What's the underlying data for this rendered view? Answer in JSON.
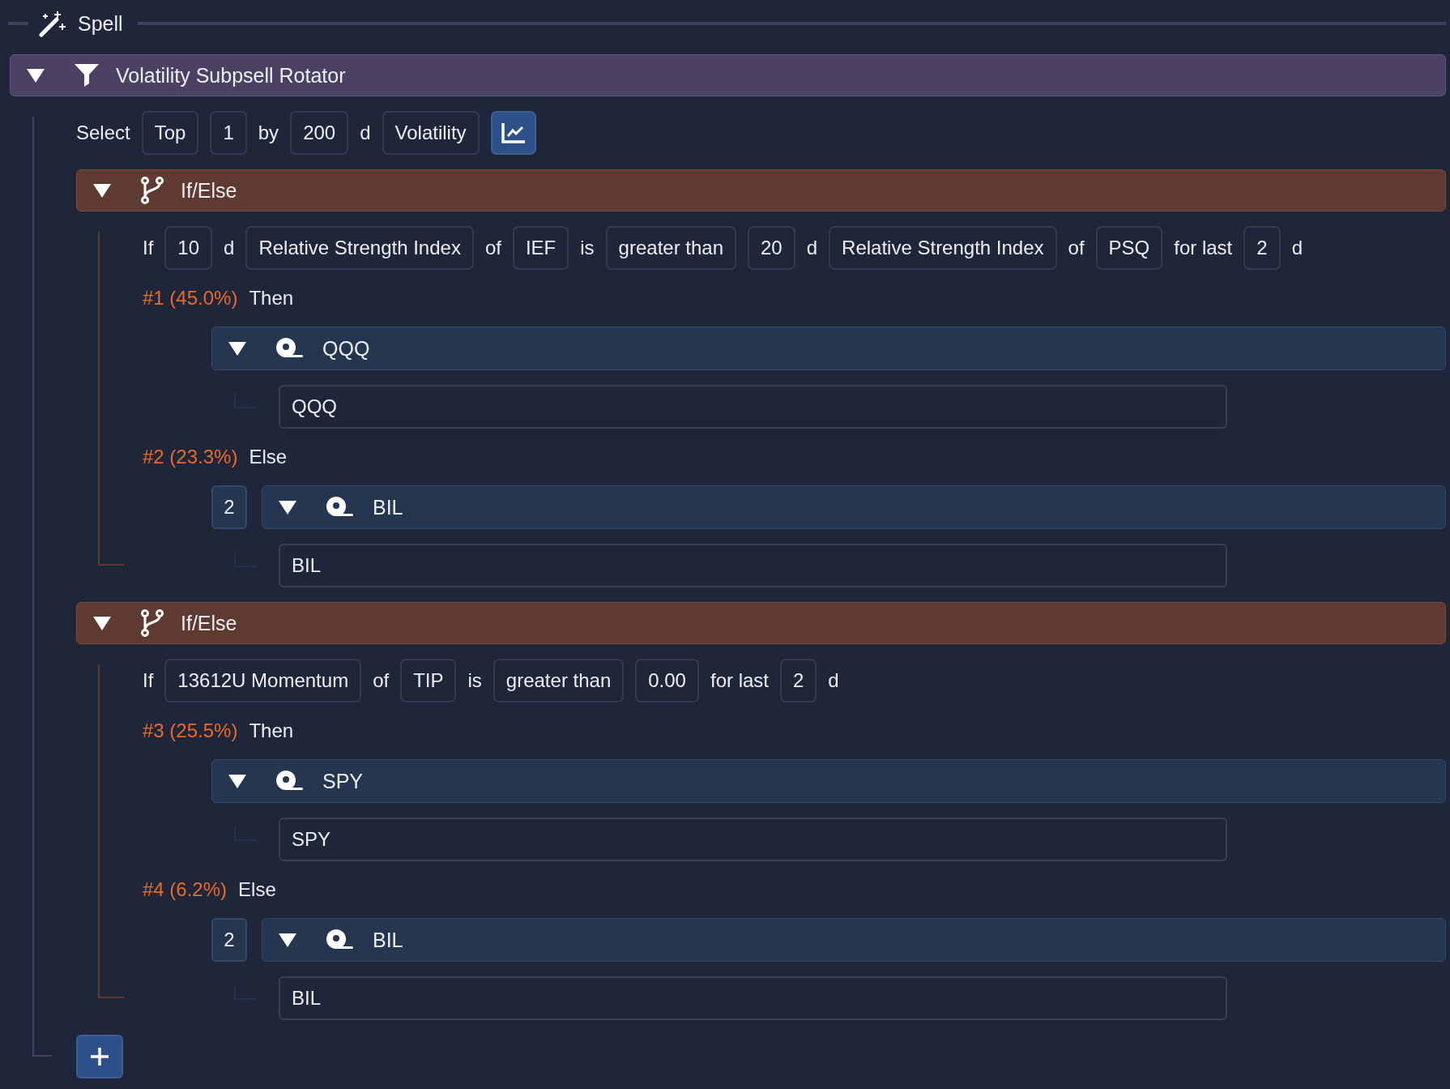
{
  "header": {
    "title": "Spell"
  },
  "filter": {
    "title": "Volatility Subpsell Rotator",
    "expanded": true,
    "select": [
      {
        "kind": "text",
        "text": "Select"
      },
      {
        "kind": "field",
        "text": "Top"
      },
      {
        "kind": "field",
        "text": "1"
      },
      {
        "kind": "text",
        "text": "by"
      },
      {
        "kind": "field",
        "text": "200"
      },
      {
        "kind": "text",
        "text": "d"
      },
      {
        "kind": "field",
        "text": "Volatility"
      }
    ],
    "chart_toggle": {
      "on": true
    },
    "blocks": [
      {
        "title": "If/Else",
        "expanded": true,
        "condition": [
          {
            "kind": "text",
            "text": "If"
          },
          {
            "kind": "field",
            "text": "10"
          },
          {
            "kind": "text",
            "text": "d"
          },
          {
            "kind": "field",
            "text": "Relative Strength Index"
          },
          {
            "kind": "text",
            "text": "of"
          },
          {
            "kind": "field",
            "text": "IEF"
          },
          {
            "kind": "text",
            "text": "is"
          },
          {
            "kind": "field",
            "text": "greater than"
          },
          {
            "kind": "field",
            "text": "20"
          },
          {
            "kind": "text",
            "text": "d"
          },
          {
            "kind": "field",
            "text": "Relative Strength Index"
          },
          {
            "kind": "text",
            "text": "of"
          },
          {
            "kind": "field",
            "text": "PSQ"
          },
          {
            "kind": "text",
            "text": "for last"
          },
          {
            "kind": "field",
            "text": "2"
          },
          {
            "kind": "text",
            "text": "d"
          }
        ],
        "branches": [
          {
            "label": "#1 (45.0%)",
            "word": "Then",
            "asset": {
              "title": "QQQ",
              "expanded": true,
              "value": "QQQ"
            }
          },
          {
            "label": "#2 (23.3%)",
            "word": "Else",
            "weight": "2",
            "asset": {
              "title": "BIL",
              "expanded": true,
              "value": "BIL"
            }
          }
        ]
      },
      {
        "title": "If/Else",
        "expanded": true,
        "condition": [
          {
            "kind": "text",
            "text": "If"
          },
          {
            "kind": "field",
            "text": "13612U Momentum"
          },
          {
            "kind": "text",
            "text": "of"
          },
          {
            "kind": "field",
            "text": "TIP"
          },
          {
            "kind": "text",
            "text": "is"
          },
          {
            "kind": "field",
            "text": "greater than"
          },
          {
            "kind": "field",
            "text": "0.00"
          },
          {
            "kind": "text",
            "text": "for last"
          },
          {
            "kind": "field",
            "text": "2"
          },
          {
            "kind": "text",
            "text": "d"
          }
        ],
        "branches": [
          {
            "label": "#3 (25.5%)",
            "word": "Then",
            "asset": {
              "title": "SPY",
              "expanded": true,
              "value": "SPY"
            }
          },
          {
            "label": "#4 (6.2%)",
            "word": "Else",
            "weight": "2",
            "asset": {
              "title": "BIL",
              "expanded": true,
              "value": "BIL"
            }
          }
        ]
      }
    ],
    "add_button": true
  }
}
